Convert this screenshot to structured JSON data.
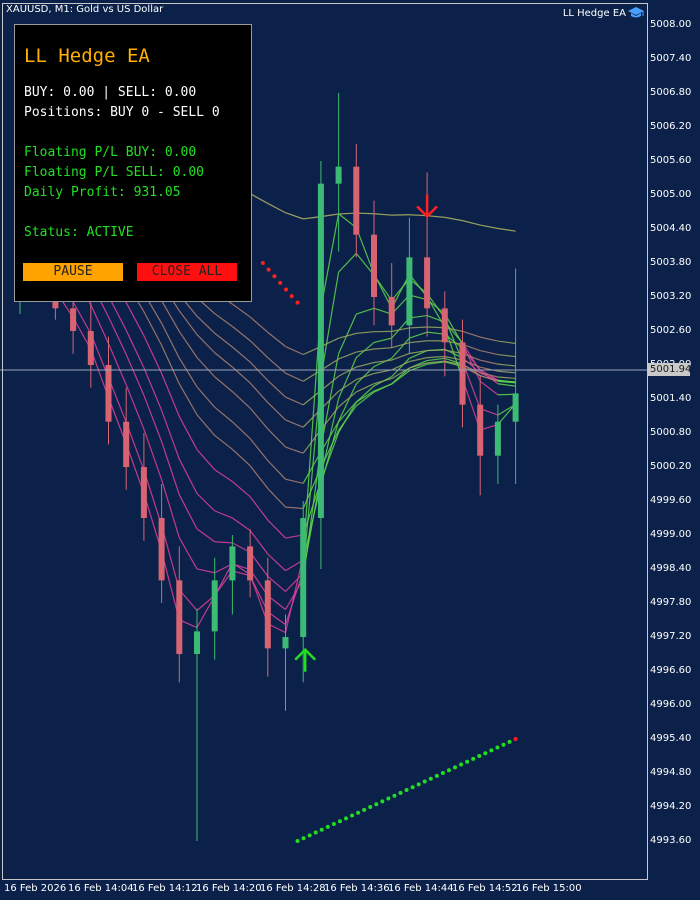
{
  "header": {
    "symbol_title": "XAUUSD, M1:  Gold vs US Dollar",
    "ea_label": "LL Hedge EA"
  },
  "panel": {
    "title": "LL Hedge EA",
    "lines": [
      "BUY: 0.00 | SELL: 0.00",
      "Positions: BUY 0 - SELL 0",
      "Floating P/L BUY: 0.00",
      "Floating P/L SELL: 0.00",
      "Daily Profit: 931.05",
      "Status: ACTIVE"
    ],
    "pause_label": "PAUSE",
    "close_all_label": "CLOSE ALL"
  },
  "current_price_label": "5001.94",
  "colors": {
    "background": "#0b2149",
    "bull_candle": "#3dba73",
    "bear_candle": "#d86472",
    "buy_arrow": "#22dd22",
    "sell_arrow": "#ff2020",
    "panel_title": "#ffb000",
    "panel_green_text": "#22e022"
  },
  "icons": [
    "graduation-cap-icon",
    "up-arrow-icon",
    "down-arrow-icon"
  ],
  "chart_data": {
    "type": "candlestick",
    "symbol": "XAUUSD",
    "timeframe": "M1",
    "y_ticks": [
      "5008.00",
      "5007.40",
      "5006.80",
      "5006.20",
      "5005.60",
      "5005.00",
      "5004.40",
      "5003.80",
      "5003.20",
      "5002.60",
      "5002.00",
      "5001.40",
      "5000.80",
      "5000.20",
      "4999.60",
      "4999.00",
      "4998.40",
      "4997.80",
      "4997.20",
      "4996.60",
      "4996.00",
      "4995.40",
      "4994.80",
      "4994.20",
      "4993.60"
    ],
    "x_ticks": [
      "16 Feb 2026",
      "16 Feb 14:04",
      "16 Feb 14:12",
      "16 Feb 14:20",
      "16 Feb 14:28",
      "16 Feb 14:36",
      "16 Feb 14:44",
      "16 Feb 14:52",
      "16 Feb 15:00"
    ],
    "current_price": 5001.94,
    "ylim": [
      4993.2,
      5008.3
    ],
    "candles": [
      {
        "o": 5003.5,
        "h": 5004.6,
        "l": 5002.9,
        "c": 5004.1
      },
      {
        "o": 5004.1,
        "h": 5004.8,
        "l": 5003.4,
        "c": 5003.6
      },
      {
        "o": 5003.6,
        "h": 5004.2,
        "l": 5002.8,
        "c": 5003.0
      },
      {
        "o": 5003.0,
        "h": 5003.6,
        "l": 5002.2,
        "c": 5002.6
      },
      {
        "o": 5002.6,
        "h": 5003.1,
        "l": 5001.6,
        "c": 5002.0
      },
      {
        "o": 5002.0,
        "h": 5002.5,
        "l": 5000.6,
        "c": 5001.0
      },
      {
        "o": 5001.0,
        "h": 5001.6,
        "l": 4999.8,
        "c": 5000.2
      },
      {
        "o": 5000.2,
        "h": 5000.8,
        "l": 4998.9,
        "c": 4999.3
      },
      {
        "o": 4999.3,
        "h": 4999.9,
        "l": 4997.8,
        "c": 4998.2
      },
      {
        "o": 4998.2,
        "h": 4998.8,
        "l": 4996.4,
        "c": 4996.9
      },
      {
        "o": 4996.9,
        "h": 4997.7,
        "l": 4993.6,
        "c": 4997.3
      },
      {
        "o": 4997.3,
        "h": 4998.6,
        "l": 4996.8,
        "c": 4998.2
      },
      {
        "o": 4998.2,
        "h": 4999.0,
        "l": 4997.6,
        "c": 4998.8
      },
      {
        "o": 4998.8,
        "h": 4999.1,
        "l": 4997.9,
        "c": 4998.2
      },
      {
        "o": 4998.2,
        "h": 4998.6,
        "l": 4996.5,
        "c": 4997.0
      },
      {
        "o": 4997.0,
        "h": 4997.6,
        "l": 4995.9,
        "c": 4997.2
      },
      {
        "o": 4997.2,
        "h": 4999.6,
        "l": 4996.4,
        "c": 4999.3
      },
      {
        "o": 4999.3,
        "h": 5005.6,
        "l": 4998.4,
        "c": 5005.2
      },
      {
        "o": 5005.2,
        "h": 5006.8,
        "l": 5004.0,
        "c": 5005.5
      },
      {
        "o": 5005.5,
        "h": 5005.9,
        "l": 5003.9,
        "c": 5004.3
      },
      {
        "o": 5004.3,
        "h": 5004.9,
        "l": 5002.7,
        "c": 5003.2
      },
      {
        "o": 5003.2,
        "h": 5003.8,
        "l": 5002.3,
        "c": 5002.7
      },
      {
        "o": 5002.7,
        "h": 5004.6,
        "l": 5002.2,
        "c": 5003.9
      },
      {
        "o": 5003.9,
        "h": 5005.4,
        "l": 5002.5,
        "c": 5003.0
      },
      {
        "o": 5003.0,
        "h": 5003.3,
        "l": 5001.8,
        "c": 5002.4
      },
      {
        "o": 5002.4,
        "h": 5002.8,
        "l": 5000.9,
        "c": 5001.3
      },
      {
        "o": 5001.3,
        "h": 5001.8,
        "l": 4999.7,
        "c": 5000.4
      },
      {
        "o": 5000.4,
        "h": 5001.3,
        "l": 4999.9,
        "c": 5001.0
      },
      {
        "o": 5001.0,
        "h": 5003.7,
        "l": 4999.9,
        "c": 5001.5
      }
    ],
    "trailing_dots": [
      {
        "side": "sell",
        "x_frac": [
          0.49,
          0.56
        ],
        "y": [
          5003.8,
          5003.1
        ],
        "color": "#ff2020"
      },
      {
        "side": "buy",
        "x_frac": [
          0.56,
          1.0
        ],
        "y": [
          4993.6,
          4995.4
        ],
        "color": "#22dd22"
      }
    ],
    "signals": [
      {
        "type": "buy",
        "price": 4996.8,
        "color": "#22dd22"
      },
      {
        "type": "sell",
        "price": 5004.8,
        "color": "#ff2020"
      }
    ]
  }
}
